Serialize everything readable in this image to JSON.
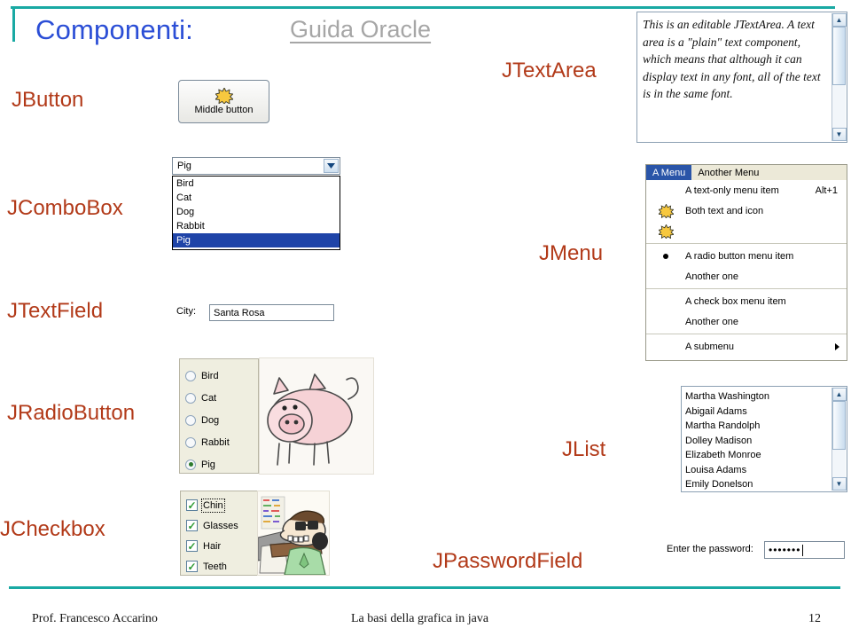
{
  "slide": {
    "title": "Componenti:",
    "link": "Guida Oracle",
    "accent_color": "#19a9a3",
    "title_color": "#2b4ed6",
    "label_color": "#b23a19"
  },
  "labels": {
    "jbutton": "JButton",
    "jcombobox": "JComboBox",
    "jtextfield": "JTextField",
    "jradiobutton": "JRadioButton",
    "jcheckbox": "JCheckbox",
    "jtextarea": "JTextArea",
    "jmenu": "JMenu",
    "jlist": "JList",
    "jpasswordfield": "JPasswordField"
  },
  "jbutton": {
    "label": "Middle button",
    "icon": "starburst-icon"
  },
  "jcombobox": {
    "selected": "Pig",
    "arrow_icon": "chevron-down-icon",
    "options": [
      "Bird",
      "Cat",
      "Dog",
      "Rabbit",
      "Pig"
    ],
    "highlighted_index": 4,
    "highlight_color": "#1f44a8"
  },
  "jtextfield": {
    "label": "City:",
    "value": "Santa Rosa"
  },
  "jradiobutton": {
    "options": [
      "Bird",
      "Cat",
      "Dog",
      "Rabbit",
      "Pig"
    ],
    "selected": "Pig"
  },
  "jcheckbox": {
    "options": [
      {
        "label": "Chin",
        "checked": true,
        "focused": true
      },
      {
        "label": "Glasses",
        "checked": true,
        "focused": false
      },
      {
        "label": "Hair",
        "checked": true,
        "focused": false
      },
      {
        "label": "Teeth",
        "checked": true,
        "focused": false
      }
    ]
  },
  "jtextarea": {
    "text": "This is an editable JTextArea. A text area is a \"plain\" text component, which means that although it can display text in any font, all of the text is in the same font.",
    "scrollbar": {
      "up_icon": "scroll-up-arrow-icon",
      "down_icon": "scroll-down-arrow-icon"
    }
  },
  "jmenu": {
    "menubar": [
      {
        "label": "A Menu",
        "active": true
      },
      {
        "label": "Another Menu",
        "active": false
      }
    ],
    "groups": [
      [
        {
          "text": "A text-only menu item",
          "accel": "Alt+1",
          "icon": "",
          "marker": ""
        },
        {
          "text": "Both text and icon",
          "accel": "",
          "icon": "starburst-icon",
          "marker": ""
        },
        {
          "text": "",
          "accel": "",
          "icon": "starburst-icon",
          "marker": ""
        }
      ],
      [
        {
          "text": "A radio button menu item",
          "accel": "",
          "icon": "",
          "marker": "radio-selected"
        },
        {
          "text": "Another one",
          "accel": "",
          "icon": "",
          "marker": ""
        }
      ],
      [
        {
          "text": "A check box menu item",
          "accel": "",
          "icon": "",
          "marker": ""
        },
        {
          "text": "Another one",
          "accel": "",
          "icon": "",
          "marker": ""
        }
      ],
      [
        {
          "text": "A submenu",
          "accel": "",
          "icon": "",
          "marker": "submenu-arrow"
        }
      ]
    ]
  },
  "jlist": {
    "items": [
      "Martha Washington",
      "Abigail Adams",
      "Martha Randolph",
      "Dolley Madison",
      "Elizabeth Monroe",
      "Louisa Adams",
      "Emily Donelson"
    ]
  },
  "jpasswordfield": {
    "label": "Enter the password:",
    "masked_value": "•••••••"
  },
  "footer": {
    "left": "Prof. Francesco Accarino",
    "center": "La basi della grafica in java",
    "right": "12"
  }
}
